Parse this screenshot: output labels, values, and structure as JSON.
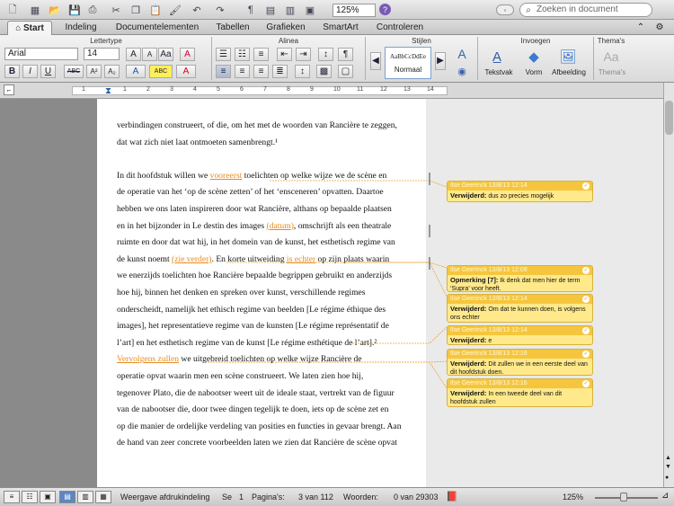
{
  "toolbar": {
    "zoom": "125%",
    "search_placeholder": "Zoeken in document",
    "icons": [
      "new-doc-icon",
      "gallery-icon",
      "open-icon",
      "save-icon",
      "print-icon",
      "cut-icon",
      "copy-icon",
      "paste-icon",
      "format-painter-icon",
      "undo-icon",
      "redo-icon",
      "table-icon",
      "columns-icon",
      "shapes-icon",
      "pilcrow-icon",
      "sidebar-icon",
      "media-icon",
      "help-icon"
    ]
  },
  "ribbon_tabs": [
    "Start",
    "Indeling",
    "Documentelementen",
    "Tabellen",
    "Grafieken",
    "SmartArt",
    "Controleren"
  ],
  "ribbon": {
    "groups": {
      "font": "Lettertype",
      "paragraph": "Alinea",
      "styles": "Stijlen",
      "insert": "Invoegen",
      "themes": "Thema's"
    },
    "font_name": "Arial",
    "font_size": "14",
    "style_sample": "AaBbCcDdEe",
    "style_name": "Normaal",
    "insert_labels": [
      "Tekstvak",
      "Vorm",
      "Afbeelding"
    ],
    "themes_label": "Thema's",
    "font_buttons": [
      "B",
      "I",
      "U",
      "ABC",
      "A²",
      "A₂",
      "A",
      "ABC",
      "A"
    ]
  },
  "ruler": {
    "ticks": [
      "1",
      "1",
      "2",
      "3",
      "4",
      "5",
      "6",
      "7",
      "8",
      "9",
      "10",
      "11",
      "12",
      "13",
      "14"
    ]
  },
  "document": {
    "lines": [
      {
        "parts": [
          {
            "t": "verbindingen construeert, of die, om het met de woorden van Rancière te zeggen,"
          }
        ]
      },
      {
        "parts": [
          {
            "t": "dat wat zich niet laat ontmoeten samenbrengt.¹"
          }
        ]
      },
      {
        "parts": [
          {
            "t": ""
          }
        ]
      },
      {
        "parts": [
          {
            "t": "      In dit hoofdstuk willen we "
          },
          {
            "t": "vooreerst",
            "ins": true
          },
          {
            "t": " toelichten op welke wijze we de scène en"
          }
        ]
      },
      {
        "parts": [
          {
            "t": "de operatie van het ‘op de scène zetten’ of het ‘ensceneren’ opvatten. Daartoe"
          }
        ]
      },
      {
        "parts": [
          {
            "t": "hebben we ons laten inspireren door wat Rancière, althans op bepaalde plaatsen"
          }
        ]
      },
      {
        "parts": [
          {
            "t": "en in het bijzonder in Le destin des images "
          },
          {
            "t": "(datum)",
            "ins": true
          },
          {
            "t": ", omschrijft als een theatrale"
          }
        ]
      },
      {
        "parts": [
          {
            "t": "ruimte en door dat wat hij, in het domein van de kunst, het esthetisch regime van"
          }
        ]
      },
      {
        "parts": [
          {
            "t": "de kunst noemt "
          },
          {
            "t": "(zie verder)",
            "ins": true
          },
          {
            "t": ". En korte uitweiding "
          },
          {
            "t": "is echter",
            "ins": true
          },
          {
            "t": " op zijn plaats waarin"
          }
        ]
      },
      {
        "parts": [
          {
            "t": "we enerzijds toelichten hoe Rancière bepaalde begrippen gebruikt en anderzijds"
          }
        ]
      },
      {
        "parts": [
          {
            "t": "hoe hij, binnen het denken en spreken over kunst, verschillende regimes"
          }
        ]
      },
      {
        "parts": [
          {
            "t": "onderscheidt, namelijk het ethisch regime van beelden [Le régime éthique des"
          }
        ]
      },
      {
        "parts": [
          {
            "t": "images], het representatieve regime van de kunsten [Le régime représentatif de"
          }
        ]
      },
      {
        "parts": [
          {
            "t": "l’art] en het esthetisch regime van de kunst [Le régime esthétique de l’art].²"
          }
        ]
      },
      {
        "parts": [
          {
            "t": "      "
          },
          {
            "t": "Vervolgens zullen",
            "ins": true
          },
          {
            "t": " we uitgebreid toelichten op welke wijze Rancière de"
          }
        ]
      },
      {
        "parts": [
          {
            "t": "operatie opvat waarin men een scène construeert. We laten zien hoe hij,"
          }
        ]
      },
      {
        "parts": [
          {
            "t": "tegenover Plato, die de nabootser weert uit de ideale staat, vertrekt van de figuur"
          }
        ]
      },
      {
        "parts": [
          {
            "t": "van de nabootser die, door twee dingen tegelijk te doen, iets op de scène zet en"
          }
        ]
      },
      {
        "parts": [
          {
            "t": "op die manier de ordelijke verdeling van posities en functies in gevaar brengt. Aan"
          }
        ]
      },
      {
        "parts": [
          {
            "t": "de hand van zeer concrete voorbeelden laten we zien dat Rancière de scène opvat"
          }
        ]
      }
    ]
  },
  "comments": [
    {
      "author": "Ilse Geerinck 13/8/13 12:14",
      "label": "Verwijderd:",
      "text": "dus zo precies mogelijk"
    },
    {
      "author": "Ilse Geerinck 13/8/13 12:09",
      "label": "Opmerking [7]:",
      "text": "Ik denk dat men hier de term ‘Supra’ voor heeft."
    },
    {
      "author": "Ilse Geerinck 13/8/13 12:14",
      "label": "Verwijderd:",
      "text": "Om dat te kunnen doen, is volgens ons echter"
    },
    {
      "author": "Ilse Geerinck 13/8/13 12:14",
      "label": "Verwijderd:",
      "text": "e"
    },
    {
      "author": "Ilse Geerinck 13/8/13 12:16",
      "label": "Verwijderd:",
      "text": "Dit zullen we in een eerste deel van dit hoofdstuk doen."
    },
    {
      "author": "Ilse Geerinck 13/8/13 12:16",
      "label": "Verwijderd:",
      "text": "In een tweede deel van dit hoofdstuk zullen"
    }
  ],
  "status": {
    "view": "Weergave afdrukindeling",
    "se_label": "Se",
    "se_value": "1",
    "pages_label": "Pagina's:",
    "pages_value": "3 van 112",
    "words_label": "Woorden:",
    "words_value": "0 van 29303",
    "zoom": "125%"
  }
}
